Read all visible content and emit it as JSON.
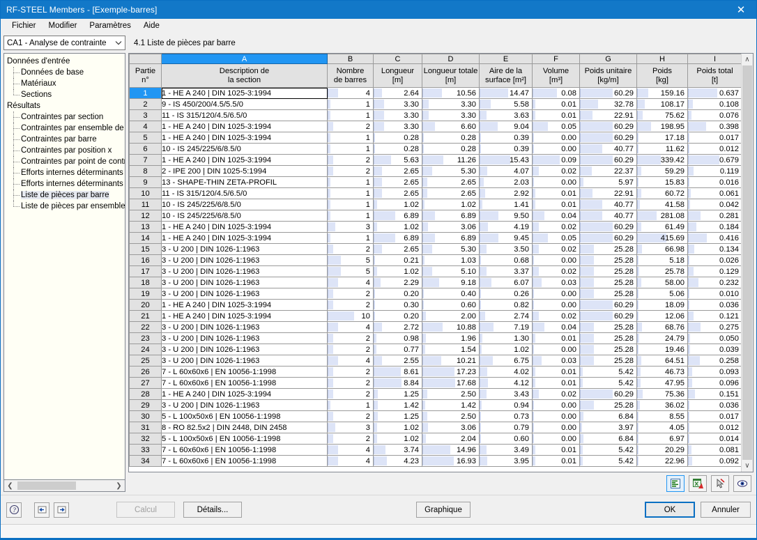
{
  "window": {
    "title": "RF-STEEL Members - [Exemple-barres]",
    "close_label": "✕",
    "accent_color": "#1278c8"
  },
  "menu": {
    "items": [
      {
        "label": "Fichier"
      },
      {
        "label": "Modifier"
      },
      {
        "label": "Paramètres"
      },
      {
        "label": "Aide"
      }
    ]
  },
  "case_selector": {
    "value": "CA1 - Analyse de contrainte",
    "arrow": "⌄"
  },
  "tree": {
    "nodes": [
      {
        "label": "Données d'entrée",
        "level": 0,
        "selected": false
      },
      {
        "label": "Données de base",
        "level": 1,
        "selected": false
      },
      {
        "label": "Matériaux",
        "level": 1,
        "selected": false
      },
      {
        "label": "Sections",
        "level": 1,
        "selected": false,
        "last": true
      },
      {
        "label": "Résultats",
        "level": 0,
        "selected": false
      },
      {
        "label": "Contraintes par section",
        "level": 1,
        "selected": false
      },
      {
        "label": "Contraintes par ensemble de barres",
        "level": 1,
        "selected": false
      },
      {
        "label": "Contraintes par barre",
        "level": 1,
        "selected": false
      },
      {
        "label": "Contraintes par position x",
        "level": 1,
        "selected": false
      },
      {
        "label": "Contraintes par point de contrainte",
        "level": 1,
        "selected": false
      },
      {
        "label": "Efforts internes déterminants par barre",
        "level": 1,
        "selected": false
      },
      {
        "label": "Efforts internes déterminants par ensemble de barres",
        "level": 1,
        "selected": false
      },
      {
        "label": "Liste de pièces par barre",
        "level": 1,
        "selected": true
      },
      {
        "label": "Liste de pièces par ensemble de barres",
        "level": 1,
        "selected": false,
        "last": true
      }
    ]
  },
  "table": {
    "caption": "4.1 Liste de pièces par barre",
    "selected_column_letter": "A",
    "selected_row": 1,
    "column_letters": [
      "A",
      "B",
      "C",
      "D",
      "E",
      "F",
      "G",
      "H",
      "I"
    ],
    "rowheader": {
      "line1": "Partie",
      "line2": "n°"
    },
    "columns": [
      {
        "letter": "A",
        "line1": "Description de",
        "line2": "la section"
      },
      {
        "letter": "B",
        "line1": "Nombre",
        "line2": "de barres"
      },
      {
        "letter": "C",
        "line1": "Longueur",
        "line2": "[m]"
      },
      {
        "letter": "D",
        "line1": "Longueur totale",
        "line2": "[m]"
      },
      {
        "letter": "E",
        "line1": "Aire de la",
        "line2": "surface [m²]"
      },
      {
        "letter": "F",
        "line1": "Volume",
        "line2": "[m³]"
      },
      {
        "letter": "G",
        "line1": "Poids unitaire",
        "line2": "[kg/m]"
      },
      {
        "letter": "H",
        "line1": "Poids",
        "line2": "[kg]"
      },
      {
        "letter": "I",
        "line1": "Poids total",
        "line2": "[t]"
      }
    ],
    "rows": [
      {
        "n": "1",
        "desc": "1 - HE A 240 | DIN 1025-3:1994",
        "nb": "4",
        "lng": "2.64",
        "lngt": "10.56",
        "aire": "14.47",
        "vol": "0.08",
        "pu": "60.29",
        "poids": "159.16",
        "pt": "0.637"
      },
      {
        "n": "2",
        "desc": "9 - IS 450/200/4.5/5.5/0",
        "nb": "1",
        "lng": "3.30",
        "lngt": "3.30",
        "aire": "5.58",
        "vol": "0.01",
        "pu": "32.78",
        "poids": "108.17",
        "pt": "0.108"
      },
      {
        "n": "3",
        "desc": "11 - IS 315/120/4.5/6.5/0",
        "nb": "1",
        "lng": "3.30",
        "lngt": "3.30",
        "aire": "3.63",
        "vol": "0.01",
        "pu": "22.91",
        "poids": "75.62",
        "pt": "0.076"
      },
      {
        "n": "4",
        "desc": "1 - HE A 240 | DIN 1025-3:1994",
        "nb": "2",
        "lng": "3.30",
        "lngt": "6.60",
        "aire": "9.04",
        "vol": "0.05",
        "pu": "60.29",
        "poids": "198.95",
        "pt": "0.398"
      },
      {
        "n": "5",
        "desc": "1 - HE A 240 | DIN 1025-3:1994",
        "nb": "1",
        "lng": "0.28",
        "lngt": "0.28",
        "aire": "0.39",
        "vol": "0.00",
        "pu": "60.29",
        "poids": "17.18",
        "pt": "0.017"
      },
      {
        "n": "6",
        "desc": "10 - IS 245/225/6/8.5/0",
        "nb": "1",
        "lng": "0.28",
        "lngt": "0.28",
        "aire": "0.39",
        "vol": "0.00",
        "pu": "40.77",
        "poids": "11.62",
        "pt": "0.012"
      },
      {
        "n": "7",
        "desc": "1 - HE A 240 | DIN 1025-3:1994",
        "nb": "2",
        "lng": "5.63",
        "lngt": "11.26",
        "aire": "15.43",
        "vol": "0.09",
        "pu": "60.29",
        "poids": "339.42",
        "pt": "0.679"
      },
      {
        "n": "8",
        "desc": "2 - IPE 200 | DIN 1025-5:1994",
        "nb": "2",
        "lng": "2.65",
        "lngt": "5.30",
        "aire": "4.07",
        "vol": "0.02",
        "pu": "22.37",
        "poids": "59.29",
        "pt": "0.119"
      },
      {
        "n": "9",
        "desc": "13 - SHAPE-THIN ZETA-PROFIL",
        "nb": "1",
        "lng": "2.65",
        "lngt": "2.65",
        "aire": "2.03",
        "vol": "0.00",
        "pu": "5.97",
        "poids": "15.83",
        "pt": "0.016"
      },
      {
        "n": "10",
        "desc": "11 - IS 315/120/4.5/6.5/0",
        "nb": "1",
        "lng": "2.65",
        "lngt": "2.65",
        "aire": "2.92",
        "vol": "0.01",
        "pu": "22.91",
        "poids": "60.72",
        "pt": "0.061"
      },
      {
        "n": "11",
        "desc": "10 - IS 245/225/6/8.5/0",
        "nb": "1",
        "lng": "1.02",
        "lngt": "1.02",
        "aire": "1.41",
        "vol": "0.01",
        "pu": "40.77",
        "poids": "41.58",
        "pt": "0.042"
      },
      {
        "n": "12",
        "desc": "10 - IS 245/225/6/8.5/0",
        "nb": "1",
        "lng": "6.89",
        "lngt": "6.89",
        "aire": "9.50",
        "vol": "0.04",
        "pu": "40.77",
        "poids": "281.08",
        "pt": "0.281"
      },
      {
        "n": "13",
        "desc": "1 - HE A 240 | DIN 1025-3:1994",
        "nb": "3",
        "lng": "1.02",
        "lngt": "3.06",
        "aire": "4.19",
        "vol": "0.02",
        "pu": "60.29",
        "poids": "61.49",
        "pt": "0.184"
      },
      {
        "n": "14",
        "desc": "1 - HE A 240 | DIN 1025-3:1994",
        "nb": "1",
        "lng": "6.89",
        "lngt": "6.89",
        "aire": "9.45",
        "vol": "0.05",
        "pu": "60.29",
        "poids": "415.69",
        "pt": "0.416"
      },
      {
        "n": "15",
        "desc": "3 - U 200 | DIN 1026-1:1963",
        "nb": "2",
        "lng": "2.65",
        "lngt": "5.30",
        "aire": "3.50",
        "vol": "0.02",
        "pu": "25.28",
        "poids": "66.98",
        "pt": "0.134"
      },
      {
        "n": "16",
        "desc": "3 - U 200 | DIN 1026-1:1963",
        "nb": "5",
        "lng": "0.21",
        "lngt": "1.03",
        "aire": "0.68",
        "vol": "0.00",
        "pu": "25.28",
        "poids": "5.18",
        "pt": "0.026"
      },
      {
        "n": "17",
        "desc": "3 - U 200 | DIN 1026-1:1963",
        "nb": "5",
        "lng": "1.02",
        "lngt": "5.10",
        "aire": "3.37",
        "vol": "0.02",
        "pu": "25.28",
        "poids": "25.78",
        "pt": "0.129"
      },
      {
        "n": "18",
        "desc": "3 - U 200 | DIN 1026-1:1963",
        "nb": "4",
        "lng": "2.29",
        "lngt": "9.18",
        "aire": "6.07",
        "vol": "0.03",
        "pu": "25.28",
        "poids": "58.00",
        "pt": "0.232"
      },
      {
        "n": "19",
        "desc": "3 - U 200 | DIN 1026-1:1963",
        "nb": "2",
        "lng": "0.20",
        "lngt": "0.40",
        "aire": "0.26",
        "vol": "0.00",
        "pu": "25.28",
        "poids": "5.06",
        "pt": "0.010"
      },
      {
        "n": "20",
        "desc": "1 - HE A 240 | DIN 1025-3:1994",
        "nb": "2",
        "lng": "0.30",
        "lngt": "0.60",
        "aire": "0.82",
        "vol": "0.00",
        "pu": "60.29",
        "poids": "18.09",
        "pt": "0.036"
      },
      {
        "n": "21",
        "desc": "1 - HE A 240 | DIN 1025-3:1994",
        "nb": "10",
        "lng": "0.20",
        "lngt": "2.00",
        "aire": "2.74",
        "vol": "0.02",
        "pu": "60.29",
        "poids": "12.06",
        "pt": "0.121"
      },
      {
        "n": "22",
        "desc": "3 - U 200 | DIN 1026-1:1963",
        "nb": "4",
        "lng": "2.72",
        "lngt": "10.88",
        "aire": "7.19",
        "vol": "0.04",
        "pu": "25.28",
        "poids": "68.76",
        "pt": "0.275"
      },
      {
        "n": "23",
        "desc": "3 - U 200 | DIN 1026-1:1963",
        "nb": "2",
        "lng": "0.98",
        "lngt": "1.96",
        "aire": "1.30",
        "vol": "0.01",
        "pu": "25.28",
        "poids": "24.79",
        "pt": "0.050"
      },
      {
        "n": "24",
        "desc": "3 - U 200 | DIN 1026-1:1963",
        "nb": "2",
        "lng": "0.77",
        "lngt": "1.54",
        "aire": "1.02",
        "vol": "0.00",
        "pu": "25.28",
        "poids": "19.46",
        "pt": "0.039"
      },
      {
        "n": "25",
        "desc": "3 - U 200 | DIN 1026-1:1963",
        "nb": "4",
        "lng": "2.55",
        "lngt": "10.21",
        "aire": "6.75",
        "vol": "0.03",
        "pu": "25.28",
        "poids": "64.51",
        "pt": "0.258"
      },
      {
        "n": "26",
        "desc": "7 - L 60x60x6 | EN 10056-1:1998",
        "nb": "2",
        "lng": "8.61",
        "lngt": "17.23",
        "aire": "4.02",
        "vol": "0.01",
        "pu": "5.42",
        "poids": "46.73",
        "pt": "0.093"
      },
      {
        "n": "27",
        "desc": "7 - L 60x60x6 | EN 10056-1:1998",
        "nb": "2",
        "lng": "8.84",
        "lngt": "17.68",
        "aire": "4.12",
        "vol": "0.01",
        "pu": "5.42",
        "poids": "47.95",
        "pt": "0.096"
      },
      {
        "n": "28",
        "desc": "1 - HE A 240 | DIN 1025-3:1994",
        "nb": "2",
        "lng": "1.25",
        "lngt": "2.50",
        "aire": "3.43",
        "vol": "0.02",
        "pu": "60.29",
        "poids": "75.36",
        "pt": "0.151"
      },
      {
        "n": "29",
        "desc": "3 - U 200 | DIN 1026-1:1963",
        "nb": "1",
        "lng": "1.42",
        "lngt": "1.42",
        "aire": "0.94",
        "vol": "0.00",
        "pu": "25.28",
        "poids": "36.02",
        "pt": "0.036"
      },
      {
        "n": "30",
        "desc": "5 - L 100x50x6 | EN 10056-1:1998",
        "nb": "2",
        "lng": "1.25",
        "lngt": "2.50",
        "aire": "0.73",
        "vol": "0.00",
        "pu": "6.84",
        "poids": "8.55",
        "pt": "0.017"
      },
      {
        "n": "31",
        "desc": "8 - RO 82.5x2 | DIN 2448, DIN 2458",
        "nb": "3",
        "lng": "1.02",
        "lngt": "3.06",
        "aire": "0.79",
        "vol": "0.00",
        "pu": "3.97",
        "poids": "4.05",
        "pt": "0.012"
      },
      {
        "n": "32",
        "desc": "5 - L 100x50x6 | EN 10056-1:1998",
        "nb": "2",
        "lng": "1.02",
        "lngt": "2.04",
        "aire": "0.60",
        "vol": "0.00",
        "pu": "6.84",
        "poids": "6.97",
        "pt": "0.014"
      },
      {
        "n": "33",
        "desc": "7 - L 60x60x6 | EN 10056-1:1998",
        "nb": "4",
        "lng": "3.74",
        "lngt": "14.96",
        "aire": "3.49",
        "vol": "0.01",
        "pu": "5.42",
        "poids": "20.29",
        "pt": "0.081"
      },
      {
        "n": "34",
        "desc": "7 - L 60x60x6 | EN 10056-1:1998",
        "nb": "4",
        "lng": "4.23",
        "lngt": "16.93",
        "aire": "3.95",
        "vol": "0.01",
        "pu": "5.42",
        "poids": "22.96",
        "pt": "0.092"
      }
    ]
  },
  "grid_toolbar": {
    "buttons": [
      {
        "name": "printout-report-icon",
        "active": true
      },
      {
        "name": "export-excel-icon",
        "active": false
      },
      {
        "name": "select-pointer-icon",
        "active": false
      },
      {
        "name": "view-visibility-icon",
        "active": false
      }
    ]
  },
  "footer": {
    "help_icon": "help-icon",
    "prev_icon": "previous-icon",
    "next_icon": "next-icon",
    "calcul_label": "Calcul",
    "details_label": "Détails...",
    "graphique_label": "Graphique",
    "ok_label": "OK",
    "annuler_label": "Annuler"
  },
  "scrollbars": {
    "up_arrow": "∧",
    "down_arrow": "∨",
    "left_arrow": "❮",
    "right_arrow": "❯"
  }
}
